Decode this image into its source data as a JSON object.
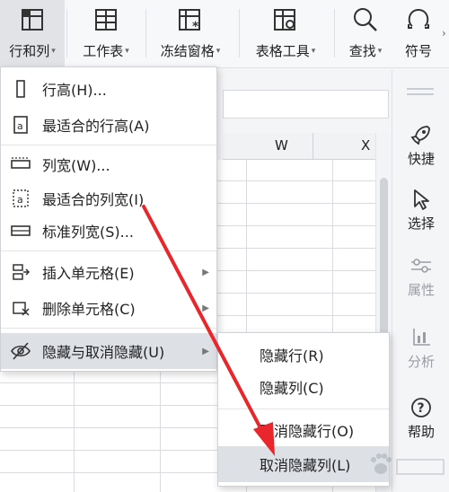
{
  "ribbon": {
    "buttons": [
      {
        "label": "行和列",
        "icon": "row-column-icon"
      },
      {
        "label": "工作表",
        "icon": "worksheet-icon"
      },
      {
        "label": "冻结窗格",
        "icon": "freeze-panes-icon"
      },
      {
        "label": "表格工具",
        "icon": "table-tools-icon"
      },
      {
        "label": "查找",
        "icon": "search-icon"
      },
      {
        "label": "符号",
        "icon": "symbol-icon"
      }
    ]
  },
  "sheet": {
    "column_headers": [
      "W",
      "X"
    ]
  },
  "right_pane": {
    "items": [
      {
        "label": "快捷",
        "icon": "rocket-icon"
      },
      {
        "label": "选择",
        "icon": "cursor-icon"
      },
      {
        "label": "属性",
        "icon": "properties-icon"
      },
      {
        "label": "分析",
        "icon": "analysis-icon"
      },
      {
        "label": "帮助",
        "icon": "help-icon"
      }
    ]
  },
  "row_col_menu": {
    "items": [
      {
        "label": "行高(H)...",
        "icon": "row-height-icon"
      },
      {
        "label": "最适合的行高(A)",
        "icon": "autofit-row-icon"
      },
      {
        "label": "列宽(W)...",
        "icon": "column-width-icon"
      },
      {
        "label": "最适合的列宽(I)",
        "icon": "autofit-column-icon"
      },
      {
        "label": "标准列宽(S)...",
        "icon": "standard-width-icon"
      },
      {
        "label": "插入单元格(E)",
        "icon": "insert-cells-icon"
      },
      {
        "label": "删除单元格(C)",
        "icon": "delete-cells-icon"
      },
      {
        "label": "隐藏与取消隐藏(U)",
        "icon": "eye-hidden-icon"
      }
    ]
  },
  "hide_submenu": {
    "items": [
      {
        "label": "隐藏行(R)"
      },
      {
        "label": "隐藏列(C)"
      },
      {
        "label": "取消隐藏行(O)"
      },
      {
        "label": "取消隐藏列(L)"
      }
    ]
  },
  "colors": {
    "annotation_arrow": "#e8262b",
    "highlight": "#dde0e5"
  }
}
